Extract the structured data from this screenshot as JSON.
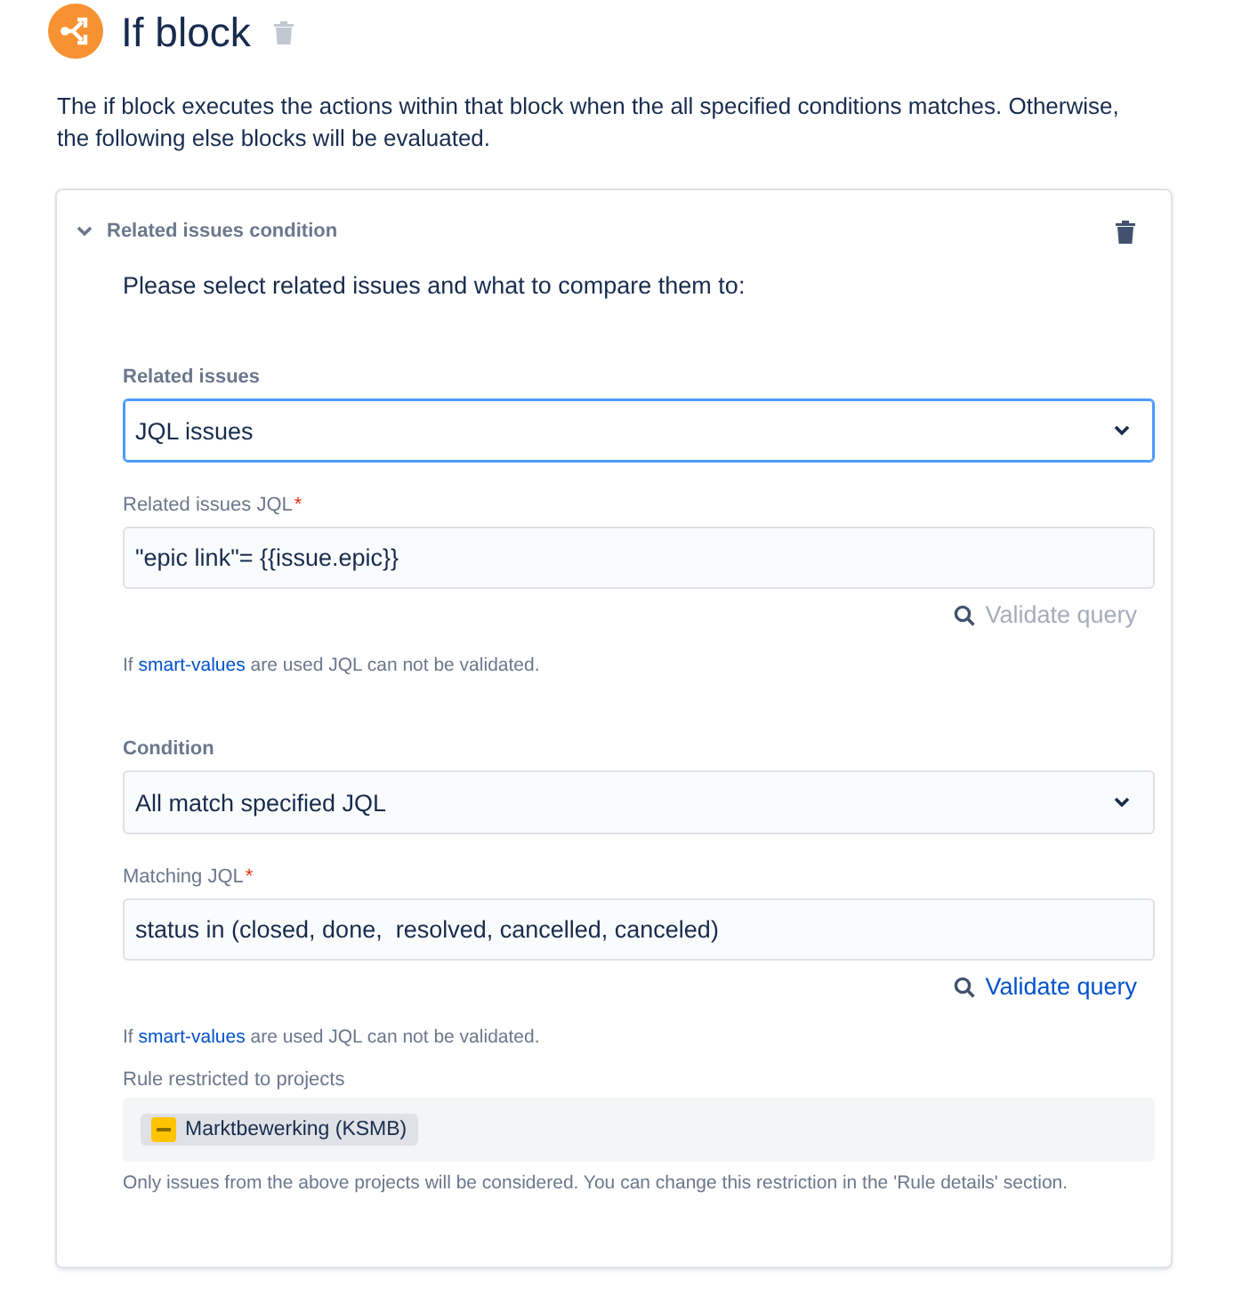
{
  "header": {
    "title": "If block"
  },
  "description": "The if block executes the actions within that block when the all specified conditions matches. Otherwise, the following else blocks will be evaluated.",
  "condition": {
    "title": "Related issues condition",
    "expanded": true,
    "intro": "Please select related issues and what to compare them to:",
    "fields": [
      {
        "kind": "select",
        "label": "Related issues",
        "value": "JQL issues",
        "focused": true
      },
      {
        "kind": "input",
        "label": "Related issues JQL",
        "required_mark": "*",
        "value": "\"epic link\"= {{issue.epic}}",
        "validate": {
          "label": "Validate query",
          "disabled": true
        },
        "help": {
          "before": "If ",
          "link": "smart-values",
          "after": " are used JQL can not be validated."
        }
      },
      {
        "kind": "select",
        "label": "Condition",
        "value": "All match specified JQL",
        "focused": false
      },
      {
        "kind": "input",
        "label": "Matching JQL",
        "required_mark": "*",
        "value": "status in (closed, done,  resolved, cancelled, canceled)",
        "validate": {
          "label": "Validate query",
          "disabled": false
        },
        "help": {
          "before": "If ",
          "link": "smart-values",
          "after": " are used JQL can not be validated."
        }
      }
    ],
    "restriction": {
      "label": "Rule restricted to projects",
      "projects": [
        {
          "name": "Marktbewerking (KSMB)"
        }
      ],
      "note": "Only issues from the above projects will be considered. You can change this restriction in the 'Rule details' section."
    }
  }
}
